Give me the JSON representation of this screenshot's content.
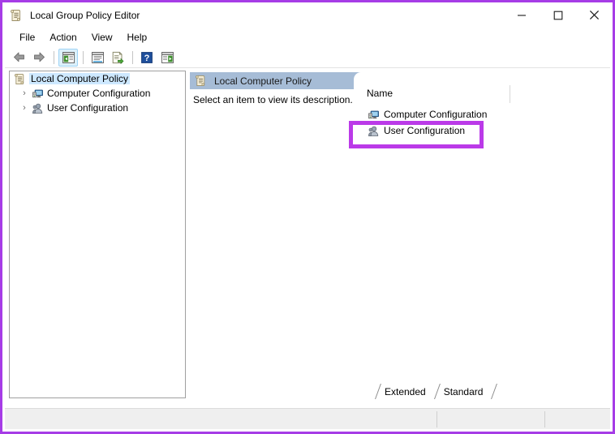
{
  "window": {
    "title": "Local Group Policy Editor",
    "title_icon": "policy-scroll-icon",
    "controls": {
      "minimize": "minimize-icon",
      "maximize": "maximize-icon",
      "close": "close-icon"
    },
    "annotation_color": "#a63ce6",
    "highlight_color": "#bb3ae8"
  },
  "menu": {
    "items": [
      {
        "label": "File"
      },
      {
        "label": "Action"
      },
      {
        "label": "View"
      },
      {
        "label": "Help"
      }
    ]
  },
  "toolbar": {
    "buttons": [
      {
        "name": "back-button",
        "icon": "left-arrow-icon",
        "active": false
      },
      {
        "name": "forward-button",
        "icon": "right-arrow-icon",
        "active": false
      },
      {
        "name": "show-hide-tree-button",
        "icon": "console-tree-icon",
        "active": true
      },
      {
        "name": "properties-button",
        "icon": "properties-window-icon",
        "active": false
      },
      {
        "name": "export-list-button",
        "icon": "export-list-icon",
        "active": false
      },
      {
        "name": "help-button",
        "icon": "question-mark-icon",
        "active": false
      },
      {
        "name": "show-action-pane-button",
        "icon": "action-pane-icon",
        "active": false
      }
    ]
  },
  "tree": {
    "items": [
      {
        "label": "Local Computer Policy",
        "icon": "policy-scroll-icon",
        "level": 1,
        "expander": "",
        "selected": true
      },
      {
        "label": "Computer Configuration",
        "icon": "computer-config-icon",
        "level": 2,
        "expander": "›",
        "selected": false
      },
      {
        "label": "User Configuration",
        "icon": "user-config-icon",
        "level": 2,
        "expander": "›",
        "selected": false
      }
    ]
  },
  "details": {
    "header_title": "Local Computer Policy",
    "header_icon": "policy-scroll-icon",
    "description": "Select an item to view its description.",
    "columns": [
      {
        "label": "Name"
      }
    ],
    "rows": [
      {
        "label": "Computer Configuration",
        "icon": "computer-config-icon",
        "highlighted": false
      },
      {
        "label": "User Configuration",
        "icon": "user-config-icon",
        "highlighted": true
      }
    ]
  },
  "tabs": {
    "items": [
      {
        "label": "Extended",
        "selected": false
      },
      {
        "label": "Standard",
        "selected": true
      }
    ]
  },
  "status_bar": {
    "segments": [
      "",
      "",
      ""
    ]
  }
}
